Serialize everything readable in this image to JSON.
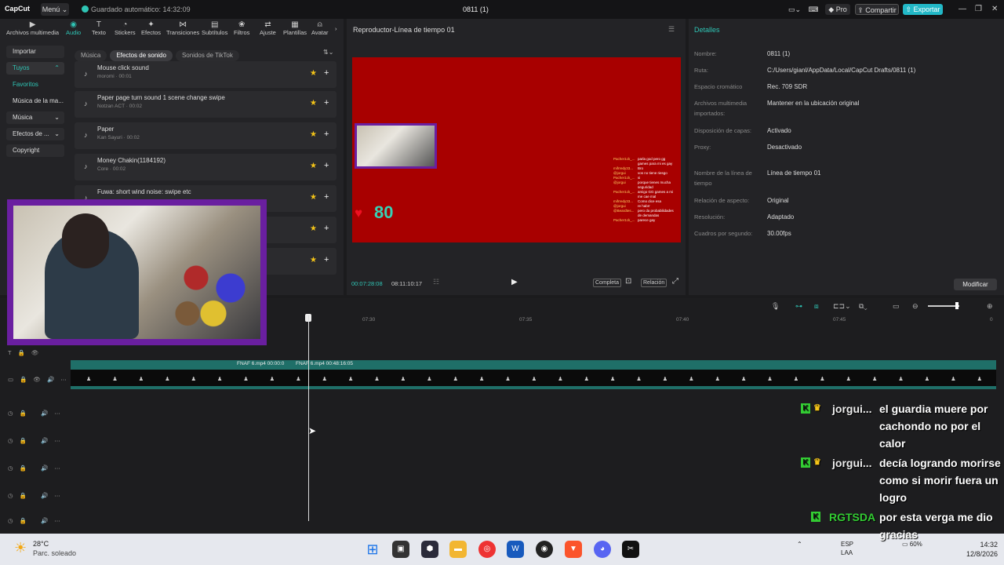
{
  "app": {
    "logo": "CapCut",
    "menu": "Menú",
    "autosave": "Guardado automático: 14:32:09",
    "project_title": "0811 (1)",
    "pro": "Pro",
    "share": "Compartir",
    "export": "Exportar"
  },
  "toolbar": [
    "Archivos multimedia",
    "Audio",
    "Texto",
    "Stickers",
    "Efectos",
    "Transiciones",
    "Subtítulos",
    "Filtros",
    "Ajuste",
    "Plantillas",
    "Avatar"
  ],
  "left_nav": {
    "import": "Importar",
    "yours": "Tuyos",
    "favorites": "Favoritos",
    "music_of": "Música de la ma...",
    "music": "Música",
    "effects": "Efectos de ...",
    "copyright": "Copyright"
  },
  "filters": [
    "Música",
    "Efectos de sonido",
    "Sonidos de TikTok"
  ],
  "sounds": [
    {
      "name": "Mouse click sound",
      "sub": "moromi · 00:01"
    },
    {
      "name": "Paper page turn sound 1 scene change swipe",
      "sub": "Notzan ACT · 00:02"
    },
    {
      "name": "Paper",
      "sub": "Kan Sayuri · 00:02"
    },
    {
      "name": "Money Chakin(1184192)",
      "sub": "Core · 00:02"
    },
    {
      "name": "Fuwa: short wind noise: swipe etc",
      "sub": ""
    },
    {
      "name": "",
      "sub": ""
    },
    {
      "name": "",
      "sub": ""
    }
  ],
  "player": {
    "title": "Reproductor-Línea de tiempo 01",
    "current": "00:07:28:08",
    "duration": "08:11:10:17",
    "complete": "Completa",
    "ratio": "Relación",
    "heart_count": "80",
    "chat": [
      {
        "u": "Pacher1ck_...",
        "m": "parla god pero gg"
      },
      {
        "u": "",
        "m": "games para mi es gay"
      },
      {
        "u": "mifrredy33...",
        "m": "Bro"
      },
      {
        "u": "@jorgui",
        "m": "vos no tiene riesgo"
      },
      {
        "u": "Pacher1ck_...",
        "m": "si"
      },
      {
        "u": "@jorgui",
        "m": "porque tienes mucha"
      },
      {
        "u": "",
        "m": "seguridad"
      },
      {
        "u": "Pacher1ck_...",
        "m": "amigo GG games a mi"
      },
      {
        "u": "",
        "m": "me cae mal"
      },
      {
        "u": "mifrredy33...",
        "m": "Como dice esa"
      },
      {
        "u": "@jorgui",
        "m": "re habrr"
      },
      {
        "u": "@Beardtes...",
        "m": "pero da probabilidades"
      },
      {
        "u": "",
        "m": "de demandas"
      },
      {
        "u": "Pacher1ck_...",
        "m": "parece gay"
      }
    ]
  },
  "details": {
    "header": "Detalles",
    "rows": [
      {
        "k": "Nombre:",
        "v": "0811 (1)"
      },
      {
        "k": "Ruta:",
        "v": "C:/Users/gianl/AppData/Local/CapCut Drafts/0811 (1)"
      },
      {
        "k": "Espacio cromático",
        "v": "Rec. 709 SDR"
      },
      {
        "k": "Archivos multimedia importados:",
        "v": "Mantener en la ubicación original"
      },
      {
        "k": "Disposición de capas:",
        "v": "Activado"
      },
      {
        "k": "Proxy:",
        "v": "Desactivado"
      },
      {
        "k": "Nombre de la línea de tiempo",
        "v": "Línea de tiempo 01"
      },
      {
        "k": "Relación de aspecto:",
        "v": "Original"
      },
      {
        "k": "Resolución:",
        "v": "Adaptado"
      },
      {
        "k": "Cuadros por segundo:",
        "v": "30.00fps"
      }
    ],
    "modify": "Modificar"
  },
  "timeline": {
    "ticks": [
      "07:30",
      "07:35",
      "07:40",
      "07:45"
    ],
    "clip1": "FNAF 6.mp4   00:00:0",
    "clip2": "FNAF 6.mp4   00:48:16:05"
  },
  "overlay_chat": [
    {
      "u": "jorgui...",
      "m": "el guardia muere por cachondo no por el calor"
    },
    {
      "u": "jorgui...",
      "m": "decía logrando morirse como si morir fuera un logro"
    },
    {
      "u": "RGTSDA",
      "m": "por esta verga me dio gracias"
    }
  ],
  "taskbar": {
    "temp": "28°C",
    "weather": "Parc. soleado",
    "lang1": "ESP",
    "lang2": "LAA",
    "battery": "60%",
    "time": "14:32",
    "date": "12/8/2026"
  },
  "colors": {
    "accent": "#2fc5b5",
    "canvas_bg": "#a80000",
    "webcam_frame": "#6a1fa0"
  }
}
